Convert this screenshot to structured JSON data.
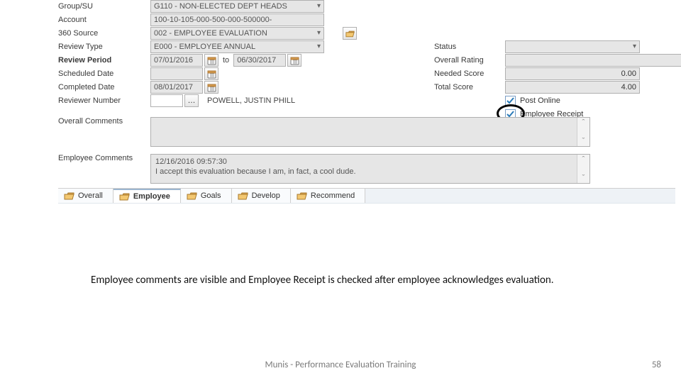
{
  "form": {
    "groupSu": {
      "label": "Group/SU",
      "value": "G110 - NON-ELECTED DEPT HEADS"
    },
    "account": {
      "label": "Account",
      "value": "100-10-105-000-500-000-500000-"
    },
    "source360": {
      "label": "360 Source",
      "value": "002 - EMPLOYEE EVALUATION"
    },
    "reviewType": {
      "label": "Review Type",
      "value": "E000 - EMPLOYEE ANNUAL"
    },
    "reviewPeriod": {
      "label": "Review Period",
      "from": "07/01/2016",
      "to_word": "to",
      "to": "06/30/2017"
    },
    "scheduledDate": {
      "label": "Scheduled Date",
      "value": ""
    },
    "completedDate": {
      "label": "Completed Date",
      "value": "08/01/2017"
    },
    "reviewerNumber": {
      "label": "Reviewer Number",
      "value": "",
      "name": "POWELL, JUSTIN PHILL"
    },
    "overallComments": {
      "label": "Overall Comments",
      "value": ""
    },
    "employeeComments": {
      "label": "Employee Comments",
      "line1": "12/16/2016 09:57:30",
      "line2": "I accept this evaluation because I am, in fact, a cool dude."
    }
  },
  "right": {
    "status": {
      "label": "Status",
      "value": ""
    },
    "overallRating": {
      "label": "Overall Rating",
      "value": ""
    },
    "neededScore": {
      "label": "Needed Score",
      "value": "0.00"
    },
    "totalScore": {
      "label": "Total Score",
      "value": "4.00"
    },
    "postOnline": {
      "label": "Post Online"
    },
    "employeeReceipt": {
      "label": "Employee Receipt"
    }
  },
  "tabs": {
    "overall": "Overall",
    "employee": "Employee",
    "goals": "Goals",
    "develop": "Develop",
    "recommend": "Recommend"
  },
  "caption": "Employee comments are visible and Employee Receipt is checked after employee acknowledges evaluation.",
  "footer": "Munis - Performance Evaluation Training",
  "page": "58"
}
